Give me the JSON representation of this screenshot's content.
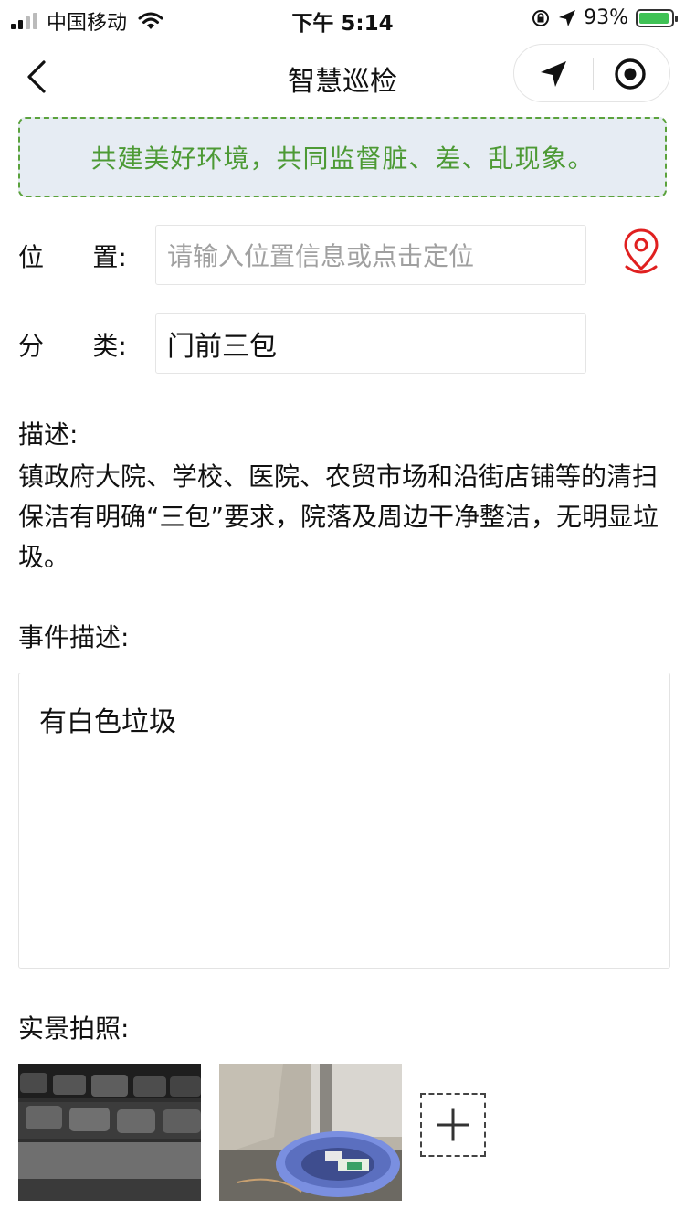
{
  "status_bar": {
    "carrier": "中国移动",
    "time": "下午 5:14",
    "battery_percent": "93%",
    "battery_level": 0.93,
    "icons": [
      "signal-icon",
      "wifi-icon",
      "orientation-lock-icon",
      "location-arrow-icon",
      "battery-icon"
    ]
  },
  "nav": {
    "title": "智慧巡检",
    "back_icon": "chevron-left-icon",
    "capsule_icons": [
      "navigation-arrow-icon",
      "target-icon"
    ]
  },
  "banner": {
    "text": "共建美好环境，共同监督脏、差、乱现象。",
    "accent_color": "#4d9a35"
  },
  "form": {
    "location": {
      "label": "位      置:",
      "placeholder": "请输入位置信息或点击定位",
      "value": "",
      "icon": "map-pin-icon"
    },
    "category": {
      "label": "分      类:",
      "value": "门前三包"
    },
    "description": {
      "label": "描述:",
      "text": "镇政府大院、学校、医院、农贸市场和沿街店铺等的清扫保洁有明确“三包”要求，院落及周边干净整洁，无明显垃圾。"
    },
    "event": {
      "label": "事件描述:",
      "value": "有白色垃圾"
    },
    "photos": {
      "label": "实景拍照:",
      "items": [
        "keyboard-photo",
        "trash-bin-photo"
      ],
      "add_icon": "plus-icon"
    }
  }
}
